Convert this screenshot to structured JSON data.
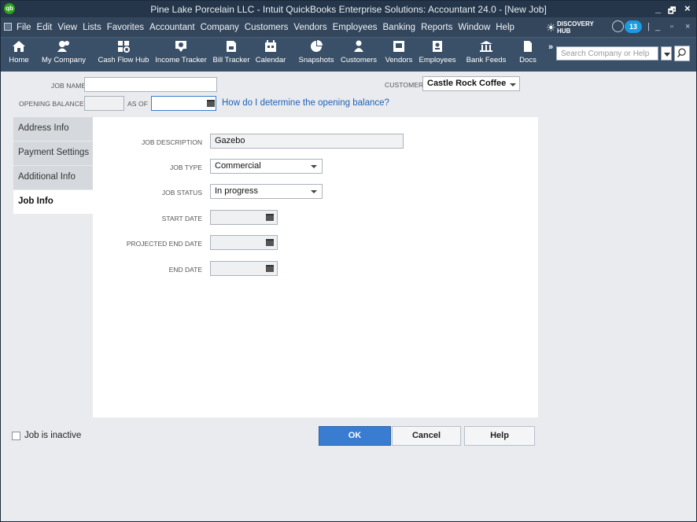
{
  "window": {
    "title": "Pine Lake Porcelain LLC  - Intuit QuickBooks Enterprise Solutions: Accountant 24.0 - [New Job]",
    "logo": "qb",
    "minimize": "_",
    "restore": "🗗",
    "close": "×"
  },
  "menubar": {
    "items": [
      "File",
      "Edit",
      "View",
      "Lists",
      "Favorites",
      "Accountant",
      "Company",
      "Customers",
      "Vendors",
      "Employees",
      "Banking",
      "Reports",
      "Window",
      "Help"
    ],
    "discovery_line1": "DISCOVERY",
    "discovery_line2": "HUB",
    "reminder_count": "13",
    "doc_min": "_",
    "doc_restore": "▫",
    "doc_close": "×"
  },
  "iconbar": {
    "items": [
      {
        "label": "Home",
        "icon": "home-icon"
      },
      {
        "label": "My Company",
        "icon": "my-company-icon"
      },
      {
        "label": "Cash Flow Hub",
        "icon": "cash-flow-hub-icon"
      },
      {
        "label": "Income Tracker",
        "icon": "income-tracker-icon"
      },
      {
        "label": "Bill Tracker",
        "icon": "bill-tracker-icon"
      },
      {
        "label": "Calendar",
        "icon": "calendar-icon"
      },
      {
        "label": "Snapshots",
        "icon": "snapshots-icon"
      },
      {
        "label": "Customers",
        "icon": "customers-icon"
      },
      {
        "label": "Vendors",
        "icon": "vendors-icon"
      },
      {
        "label": "Employees",
        "icon": "employees-icon"
      },
      {
        "label": "Bank Feeds",
        "icon": "bank-feeds-icon"
      },
      {
        "label": "Docs",
        "icon": "docs-icon"
      }
    ],
    "more": "»",
    "search_placeholder": "Search Company or Help"
  },
  "form": {
    "job_name_label": "JOB NAME",
    "job_name_value": "",
    "customer_label": "CUSTOMER",
    "customer_value": "Castle Rock Coffee",
    "opening_balance_label": "OPENING BALANCE",
    "opening_balance_value": "",
    "as_of_label": "AS OF",
    "as_of_value": "",
    "help_link": "How do I determine the opening balance?"
  },
  "tabs": [
    {
      "label": "Address Info",
      "active": false
    },
    {
      "label": "Payment Settings",
      "active": false
    },
    {
      "label": "Additional Info",
      "active": false
    },
    {
      "label": "Job Info",
      "active": true
    }
  ],
  "job_info": {
    "description_label": "JOB DESCRIPTION",
    "description_value": "Gazebo",
    "type_label": "JOB TYPE",
    "type_value": "Commercial",
    "status_label": "JOB STATUS",
    "status_value": "In progress",
    "start_label": "START DATE",
    "start_value": "",
    "projected_end_label": "PROJECTED END DATE",
    "projected_end_value": "",
    "end_label": "END DATE",
    "end_value": ""
  },
  "footer": {
    "inactive_label": "Job is inactive",
    "inactive_checked": false,
    "ok": "OK",
    "cancel": "Cancel",
    "help": "Help"
  }
}
